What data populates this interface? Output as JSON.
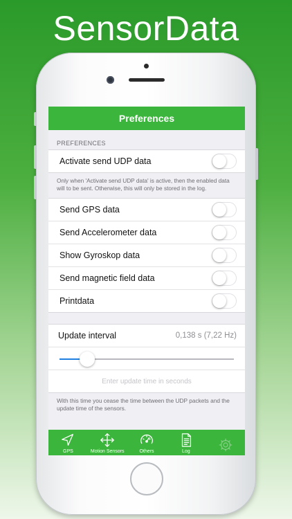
{
  "promo": {
    "headline": "SensorData"
  },
  "navbar": {
    "title": "Preferences"
  },
  "preferences": {
    "section_header": "PREFERENCES",
    "udp_toggle": {
      "label": "Activate send UDP data",
      "on": false
    },
    "udp_footnote": "Only when 'Activate send UDP data' is active, then the enabled data will to be sent. Otherwise, this will only be stored in the log.",
    "toggles": [
      {
        "label": "Send GPS data",
        "on": false
      },
      {
        "label": "Send Accelerometer data",
        "on": false
      },
      {
        "label": "Show Gyroskop data",
        "on": false
      },
      {
        "label": "Send magnetic field data",
        "on": false
      },
      {
        "label": "Printdata",
        "on": false
      }
    ]
  },
  "interval": {
    "label": "Update interval",
    "value": "0,138 s (7,22 Hz)",
    "slider_fraction": 0.16,
    "input_placeholder": "Enter update time in seconds",
    "footnote": "With this time you cease the time between the UDP packets and the update time of the sensors."
  },
  "tabbar": {
    "tabs": [
      {
        "label": "GPS",
        "icon": "location-arrow-icon"
      },
      {
        "label": "Motion Sensors",
        "icon": "move-arrows-icon"
      },
      {
        "label": "Others",
        "icon": "gauge-icon"
      },
      {
        "label": "Log",
        "icon": "document-icon"
      },
      {
        "label": "",
        "icon": "gear-icon"
      }
    ]
  },
  "colors": {
    "accent_green": "#3cb53c",
    "slider_blue": "#1f7fe0"
  }
}
